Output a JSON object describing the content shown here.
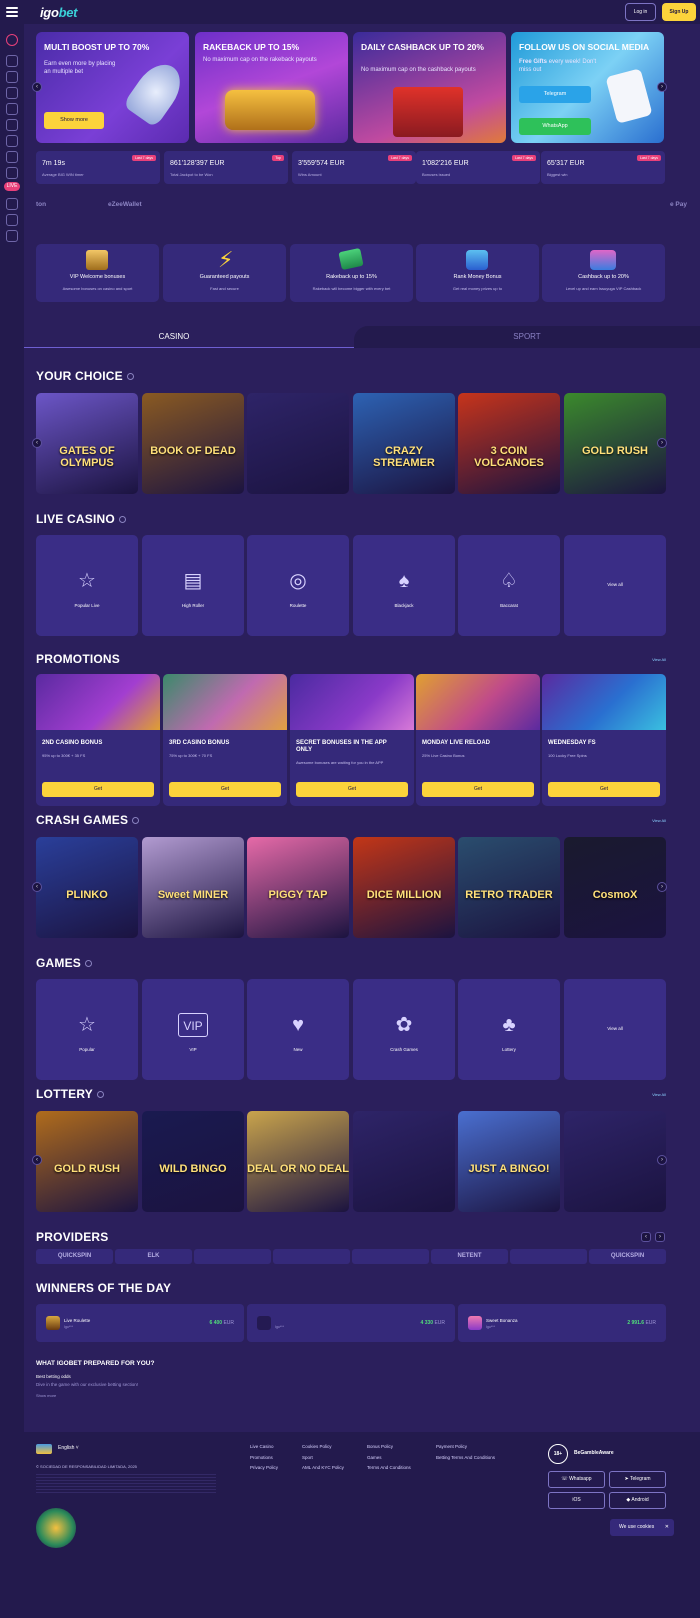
{
  "header": {
    "logo_main": "igo",
    "logo_accent": "bet",
    "login": "Log in",
    "signup": "Sign Up"
  },
  "sidebar": {
    "badge": "LIVE"
  },
  "banners": [
    {
      "title": "MULTI BOOST UP TO 70%",
      "text": "Earn even more by placing an multiple bet",
      "button": "Show more"
    },
    {
      "title": "RAKEBACK UP TO 15%",
      "text": "No maximum cap on the rakeback payouts"
    },
    {
      "title": "DAILY CASHBACK UP TO 20%",
      "text": "No maximum cap on the cashback payouts"
    },
    {
      "title": "FOLLOW US ON SOCIAL MEDIA",
      "text_bold": "Free Gifts",
      "text": "every week! Don't miss out",
      "button1": "Telegram",
      "button2": "WhatsApp"
    }
  ],
  "stats": [
    {
      "value": "7m 19s",
      "label": "Average BIG WIN timer",
      "tag": "Last 7 days"
    },
    {
      "value": "861'128'397 EUR",
      "label": "Total Jackpot to be Won",
      "tag": "Top"
    },
    {
      "value": "3'559'574 EUR",
      "label": "Wins Amount",
      "tag": "Last 7 days"
    },
    {
      "value": "1'082'216 EUR",
      "label": "Bonuses issued",
      "tag": "Last 7 days"
    },
    {
      "value": "65'317 EUR",
      "label": "Biggest win",
      "tag": "Last 7 days"
    }
  ],
  "payments": [
    "ton",
    "eZeeWallet",
    "",
    "",
    "",
    "",
    "",
    "e Pay"
  ],
  "features": [
    {
      "title": "VIP Welcome bonuses",
      "sub": "Awesome bonuses on casino and sport"
    },
    {
      "title": "Guaranteed payouts",
      "sub": "Fast and secure"
    },
    {
      "title": "Rakeback up to 15%",
      "sub": "Rakeback will become bigger with every bet"
    },
    {
      "title": "Rank Money Bonus",
      "sub": "Get real money prizes up to"
    },
    {
      "title": "Cashback up to 20%",
      "sub": "Level up and earn Issuyuga VIP Cashback"
    }
  ],
  "tabs": {
    "casino": "CASINO",
    "sport": "SPORT"
  },
  "sections": {
    "your_choice": "YOUR CHOICE",
    "live_casino": "LIVE CASINO",
    "promotions": "PROMOTIONS",
    "crash_games": "CRASH GAMES",
    "games": "GAMES",
    "lottery": "LOTTERY",
    "providers": "PROVIDERS",
    "winners": "WINNERS OF THE DAY",
    "view_all": "View All"
  },
  "your_choice": [
    {
      "name": "GATES OF OLYMPUS",
      "color": "#6c56c7"
    },
    {
      "name": "BOOK OF DEAD",
      "color": "#8a5a22"
    },
    {
      "name": "",
      "color": "#2e2468"
    },
    {
      "name": "CRAZY STREAMER",
      "color": "#2d62b3"
    },
    {
      "name": "3 COIN VOLCANOES",
      "color": "#c7341b"
    },
    {
      "name": "GOLD RUSH",
      "color": "#3b8a2c"
    }
  ],
  "live_casino": [
    "Popular Live",
    "High Roller",
    "Roulette",
    "Blackjack",
    "Baccarat",
    "View all"
  ],
  "promotions": [
    {
      "title": "2ND CASINO BONUS",
      "sub": "95% up to 300€ + 35 FS",
      "button": "Get"
    },
    {
      "title": "3RD CASINO BONUS",
      "sub": "75% up to 300€ + 70 FS",
      "button": "Get"
    },
    {
      "title": "SECRET BONUSES IN THE APP ONLY",
      "sub": "Awesome bonuses are waiting for you in the APP",
      "button": "Get"
    },
    {
      "title": "MONDAY LIVE RELOAD",
      "sub": "25% Live Casino Bonus",
      "button": "Get"
    },
    {
      "title": "WEDNESDAY FS",
      "sub": "100 Lucky Free Spins",
      "button": "Get"
    }
  ],
  "crash_games": [
    {
      "name": "PLINKO",
      "color": "#2a3f9a"
    },
    {
      "name": "Sweet MINER",
      "color": "#b29bd1"
    },
    {
      "name": "PIGGY TAP",
      "color": "#e66aa8"
    },
    {
      "name": "DICE MILLION",
      "color": "#c33617"
    },
    {
      "name": "RETRO TRADER",
      "color": "#2a4d6e"
    },
    {
      "name": "CosmoX",
      "color": "#1a1a2e"
    }
  ],
  "games": [
    "Popular",
    "VIP",
    "New",
    "Crash Games",
    "Lottery",
    "View all"
  ],
  "lottery": [
    {
      "name": "GOLD RUSH",
      "color": "#b06c1c"
    },
    {
      "name": "WILD BINGO",
      "color": "#1a1a50"
    },
    {
      "name": "DEAL OR NO DEAL",
      "color": "#c9a44c"
    },
    {
      "name": "",
      "color": "#2e2468"
    },
    {
      "name": "JUST A BINGO!",
      "color": "#4a6fd0"
    },
    {
      "name": "",
      "color": "#2e2468"
    }
  ],
  "providers": [
    "QUICKSPIN",
    "ELK",
    "",
    "",
    "",
    "NETENT",
    "",
    "QUICKSPIN"
  ],
  "winners": [
    {
      "title": "Live Roulette",
      "sub": "Igo***",
      "amount": "6 400",
      "cur": "EUR"
    },
    {
      "title": "",
      "sub": "Igo***",
      "amount": "4 330",
      "cur": "EUR"
    },
    {
      "title": "Sweet Bonanza",
      "sub": "Igo***",
      "amount": "2 991.6",
      "cur": "EUR"
    }
  ],
  "seo": {
    "title": "WHAT IGOBET PREPARED FOR YOU?",
    "sub": "Best betting odds",
    "text": "Dive in the game with our exclusive betting section!",
    "more": "Show more"
  },
  "footer": {
    "lang": "English",
    "copy": "© SOCIEDAD DE RESPONSABILIDAD LIMITADA, 2025",
    "col1": [
      "Live Casino",
      "Promotions",
      "Privacy Policy"
    ],
    "col2": [
      "Cookies Policy",
      "Sport",
      "AML And KYC Policy"
    ],
    "col3": [
      "Bonus Policy",
      "Games",
      "Terms And Conditions"
    ],
    "col4": [
      "Payment Policy",
      "Betting Terms And Conditions"
    ],
    "age": "18+",
    "gamble": "BeGambleAware",
    "whatsapp": "Whatsapp",
    "telegram": "Telegram",
    "ios": "iOS",
    "android": "Android",
    "cookie": "We use cookies"
  }
}
